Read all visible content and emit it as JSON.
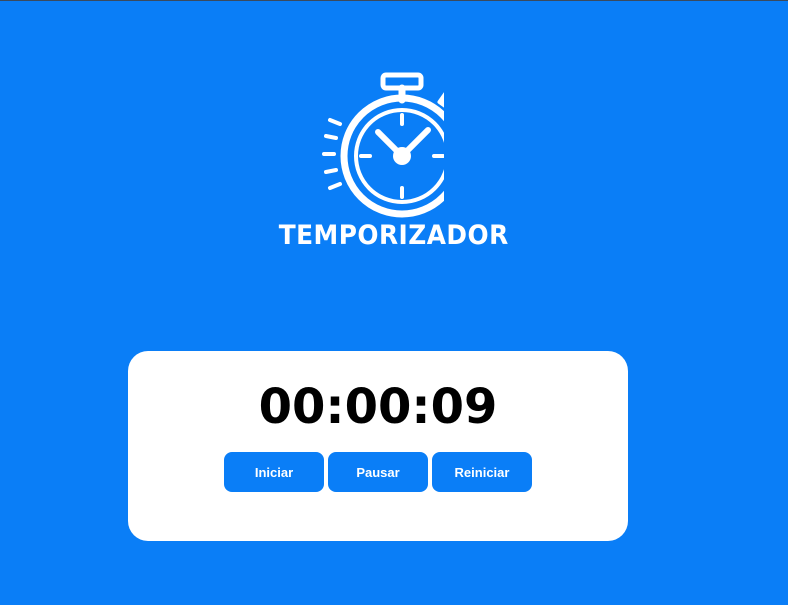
{
  "app": {
    "title": "TEMPORIZADOR",
    "logo_icon": "stopwatch-icon"
  },
  "timer": {
    "display": "00:00:09"
  },
  "controls": {
    "start_label": "Iniciar",
    "pause_label": "Pausar",
    "reset_label": "Reiniciar"
  },
  "colors": {
    "background": "#0a7ef7",
    "card": "#ffffff",
    "button": "#0a7ef7",
    "text_dark": "#000000"
  }
}
